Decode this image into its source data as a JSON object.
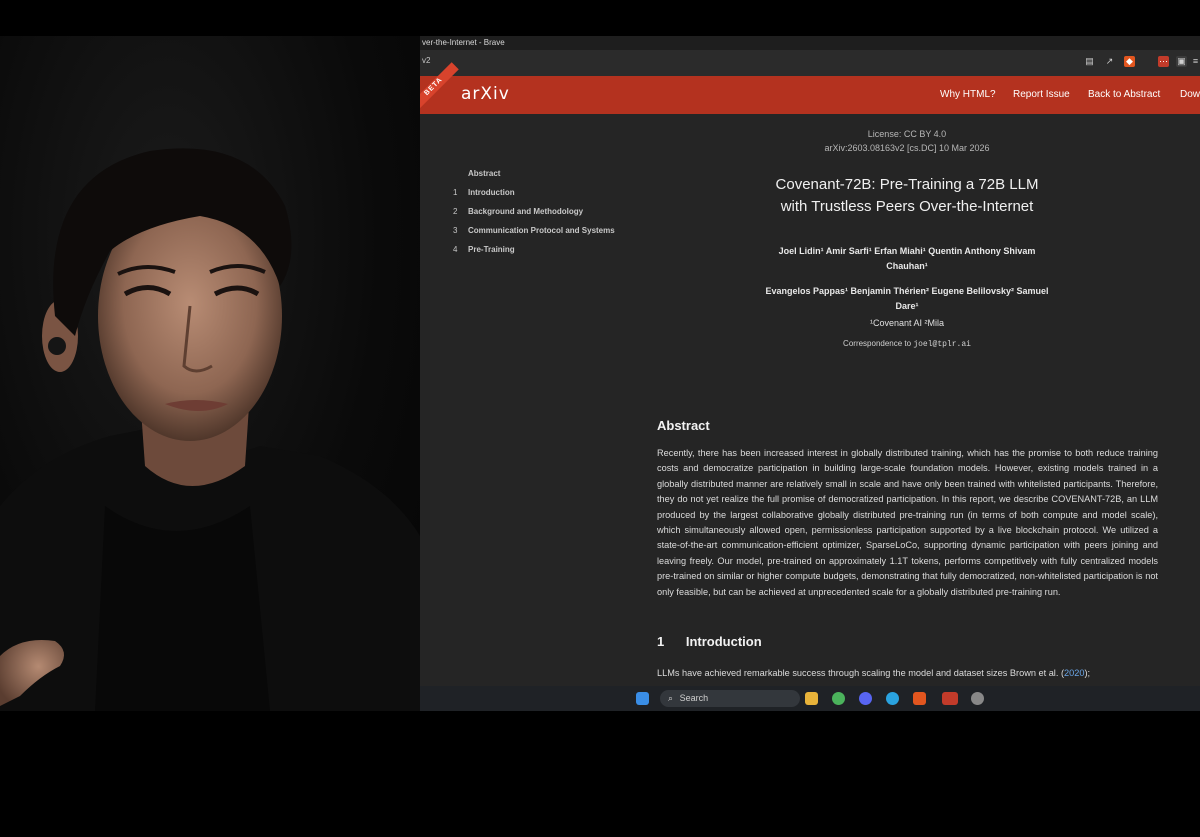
{
  "window": {
    "title": "ver-the-Internet - Brave",
    "url_fragment": "v2"
  },
  "arxiv_header": {
    "beta_badge": "BETA",
    "logo": "arXiv",
    "nav": [
      "Why HTML?",
      "Report Issue",
      "Back to Abstract",
      "Dow"
    ]
  },
  "toc": [
    {
      "num": "",
      "label": "Abstract"
    },
    {
      "num": "1",
      "label": "Introduction"
    },
    {
      "num": "2",
      "label": "Background and Methodology"
    },
    {
      "num": "3",
      "label": "Communication Protocol and Systems"
    },
    {
      "num": "4",
      "label": "Pre-Training"
    }
  ],
  "paper": {
    "license": "License: CC BY 4.0",
    "arxiv_id": "arXiv:2603.08163v2 [cs.DC] 10 Mar 2026",
    "title_line1": "Covenant-72B: Pre-Training a 72B LLM",
    "title_line2": "with Trustless Peers Over-the-Internet",
    "authors_line1": "Joel Lidin¹  Amir Sarfi¹  Erfan Miahi¹  Quentin Anthony  Shivam",
    "authors_line2": "Chauhan¹",
    "authors_line3": "Evangelos Pappas¹  Benjamin Thérien²  Eugene Belilovsky²  Samuel",
    "authors_line4": "Dare¹",
    "affiliations": "¹Covenant AI   ²Mila",
    "correspondence_label": "Correspondence to",
    "correspondence_email": "joel@tplr.ai",
    "abstract_heading": "Abstract",
    "abstract_text": "Recently, there has been increased interest in globally distributed training, which has the promise to both reduce training costs and democratize participation in building large-scale foundation models. However, existing models trained in a globally distributed manner are relatively small in scale and have only been trained with whitelisted participants. Therefore, they do not yet realize the full promise of democratized participation. In this report, we describe COVENANT-72B, an LLM produced by the largest collaborative globally distributed pre-training run (in terms of both compute and model scale), which simultaneously allowed open, permissionless participation supported by a live blockchain protocol. We utilized a state-of-the-art communication-efficient optimizer, SparseLoCo, supporting dynamic participation with peers joining and leaving freely. Our model, pre-trained on approximately 1.1T tokens, performs competitively with fully centralized models pre-trained on similar or higher compute budgets, demonstrating that fully democratized, non-whitelisted participation is not only feasible, but can be achieved at unprecedented scale for a globally distributed pre-training run.",
    "intro_num": "1",
    "intro_heading": "Introduction",
    "intro_text": "LLMs have achieved remarkable success through scaling the model and dataset sizes Brown et al. (",
    "intro_cite": "2020",
    "intro_tail": ");"
  },
  "taskbar": {
    "search_placeholder": "Search"
  },
  "colors": {
    "arxiv_red": "#b4321f",
    "doc_bg": "#252525",
    "link_blue": "#6aa5e6"
  }
}
